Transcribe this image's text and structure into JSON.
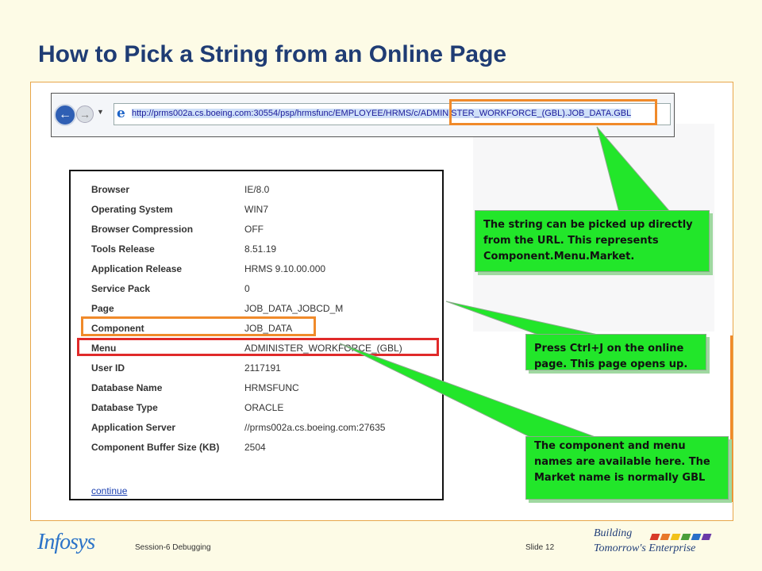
{
  "slide": {
    "title": "How to Pick a String from an Online Page",
    "footer": {
      "logo": "Infosys",
      "session": "Session-6 Debugging",
      "slide_number": "Slide 12",
      "tagline_1": "Building",
      "tagline_2": "Tomorrow's Enterprise",
      "bar_colors": [
        "#d83a2a",
        "#e8782a",
        "#f2c21a",
        "#4a9e3a",
        "#2a6fc8",
        "#6a3aa8"
      ]
    }
  },
  "browser": {
    "url": "http://prms002a.cs.boeing.com:30554/psp/hrmsfunc/EMPLOYEE/HRMS/c/ADMINISTER_WORKFORCE_(GBL).JOB_DATA.GBL",
    "back_icon": "back-arrow-icon",
    "forward_icon": "forward-arrow-icon",
    "page_icon": "ie-icon"
  },
  "info_panel": {
    "rows": [
      {
        "label": "Browser",
        "value": "IE/8.0"
      },
      {
        "label": "Operating System",
        "value": "WIN7"
      },
      {
        "label": "Browser Compression",
        "value": "OFF"
      },
      {
        "label": "Tools Release",
        "value": "8.51.19"
      },
      {
        "label": "Application Release",
        "value": "HRMS 9.10.00.000"
      },
      {
        "label": "Service Pack",
        "value": "0"
      },
      {
        "label": "Page",
        "value": "JOB_DATA_JOBCD_M"
      },
      {
        "label": "Component",
        "value": "JOB_DATA"
      },
      {
        "label": "Menu",
        "value": "ADMINISTER_WORKFORCE_(GBL)"
      },
      {
        "label": "User ID",
        "value": "2117191"
      },
      {
        "label": "Database Name",
        "value": "HRMSFUNC"
      },
      {
        "label": "Database Type",
        "value": "ORACLE"
      },
      {
        "label": "Application Server",
        "value": "//prms002a.cs.boeing.com:27635"
      },
      {
        "label": "Component Buffer Size (KB)",
        "value": "2504"
      }
    ],
    "continue": "continue"
  },
  "callouts": {
    "url": "The string can be picked up directly from the URL. This represents Component.Menu.Market.",
    "ctrlj": "Press Ctrl+J on the online page. This page opens up.",
    "component": "The component and menu names are available here. The Market name is normally GBL"
  },
  "colors": {
    "title": "#1f3c74",
    "callout_green": "#22e62a",
    "highlight_orange": "#f08a2a",
    "highlight_red": "#e02a2a"
  }
}
